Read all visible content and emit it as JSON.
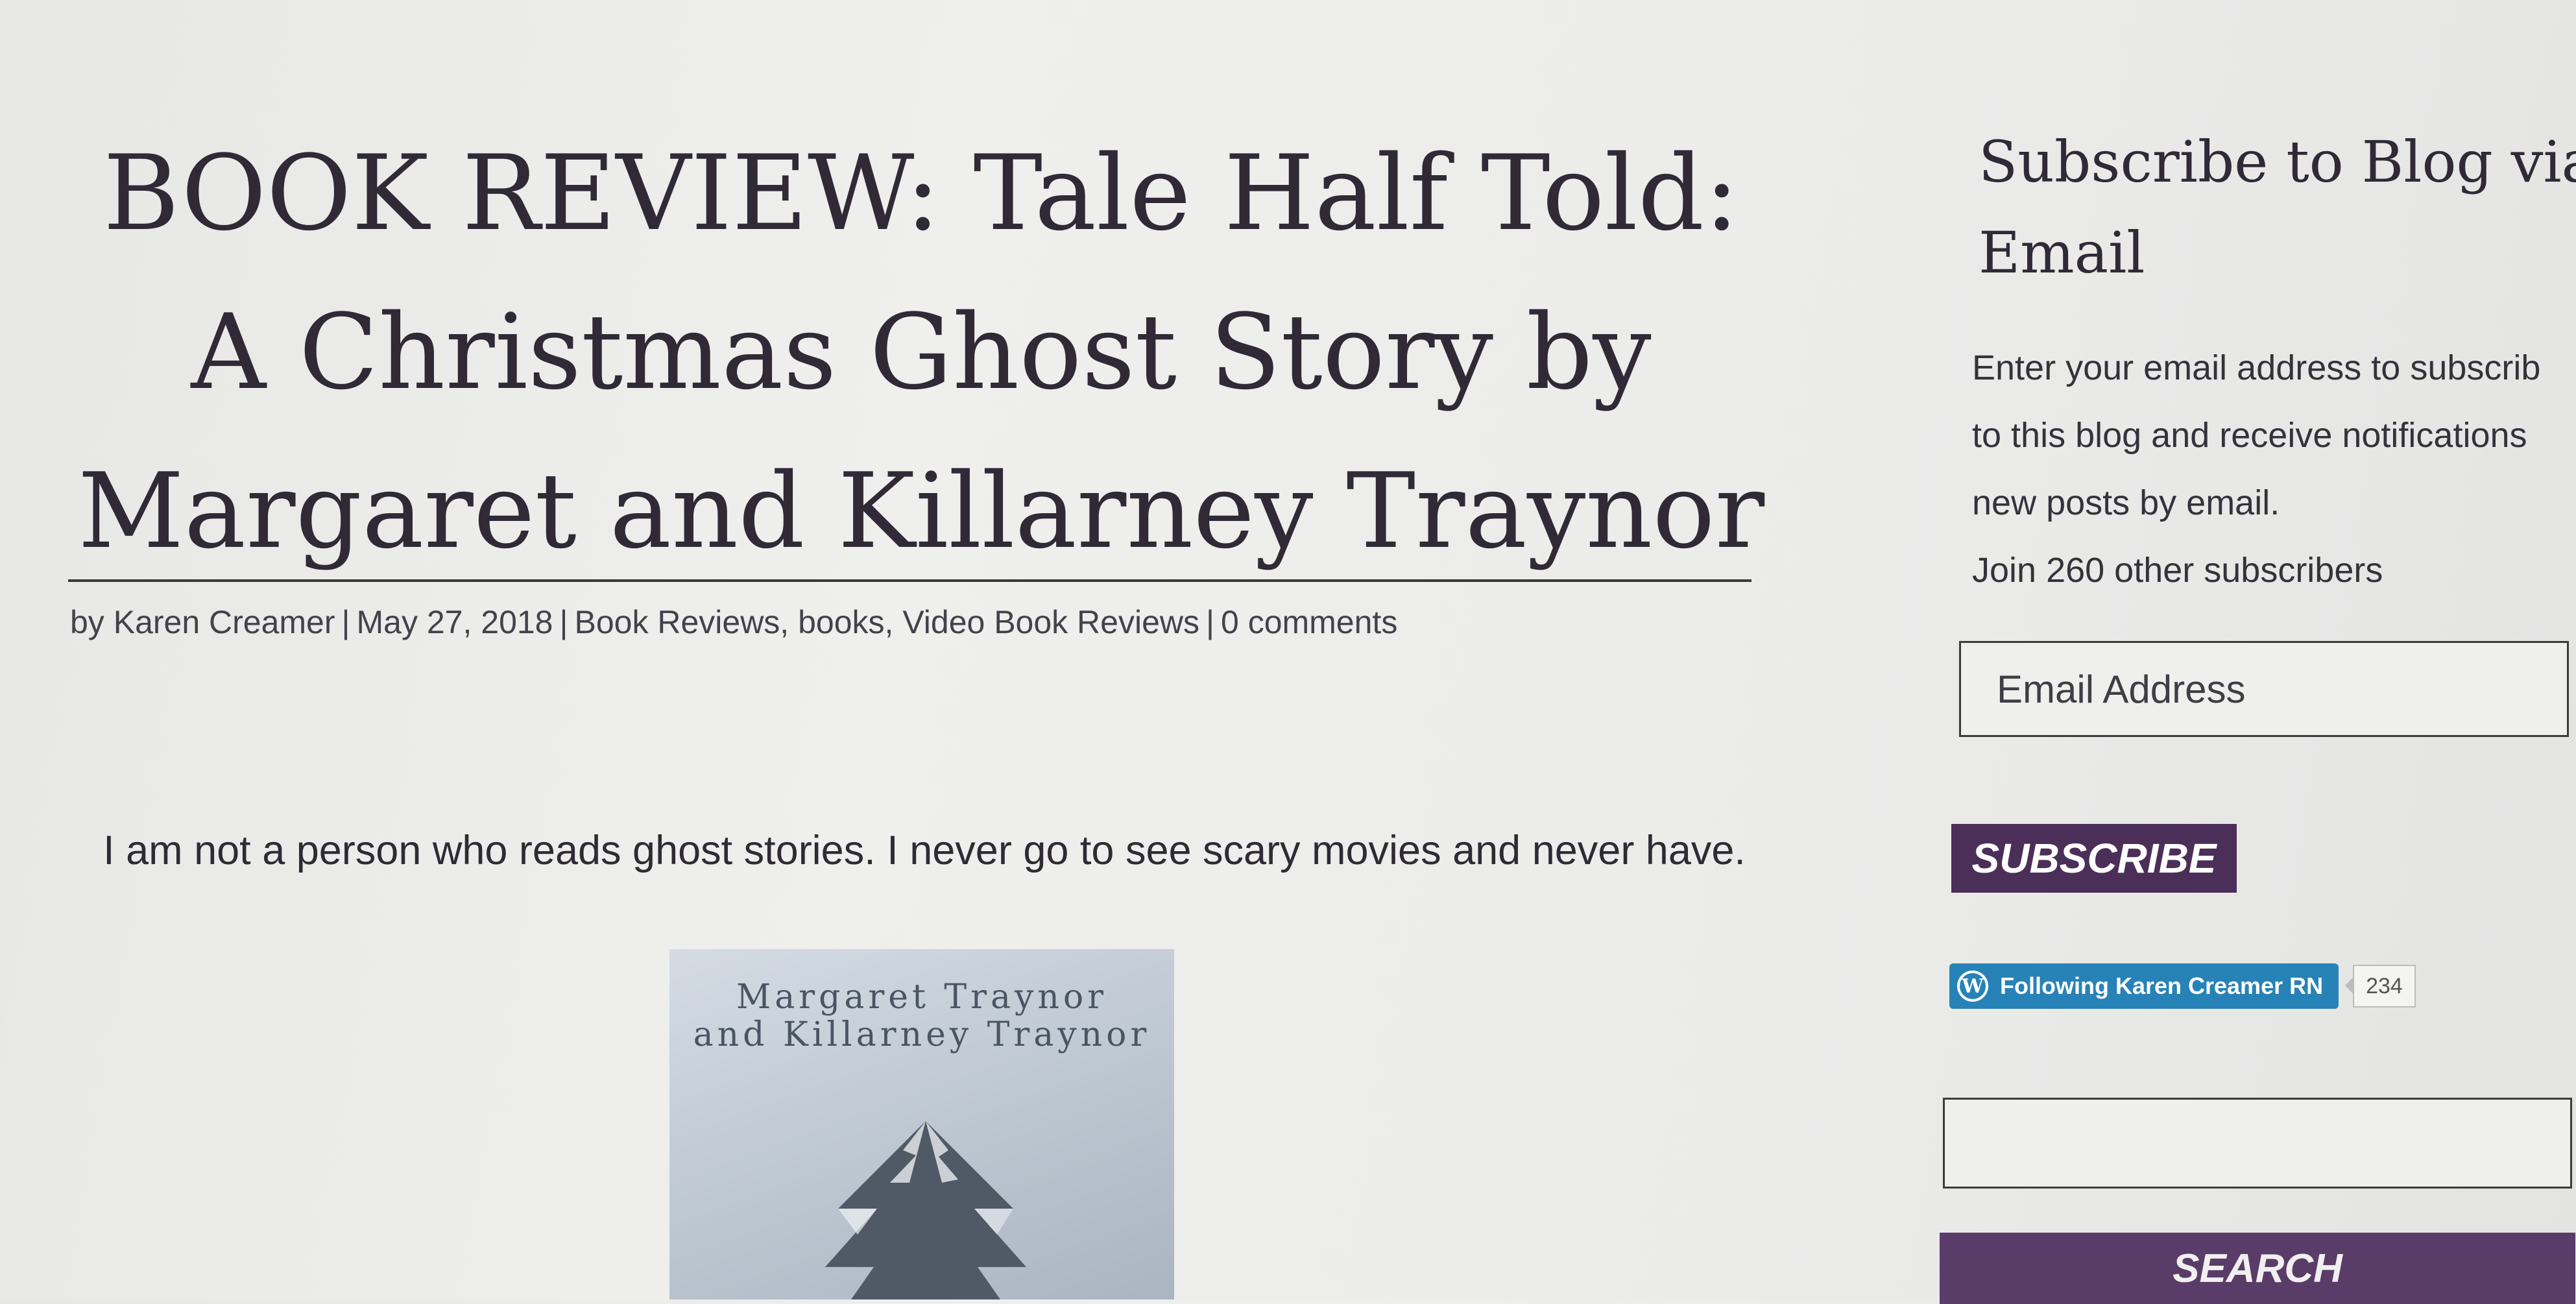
{
  "post": {
    "title": "BOOK REVIEW: Tale Half Told: A Christmas Ghost Story by Margaret and Killarney Traynor",
    "meta": {
      "by_prefix": "by",
      "author": "Karen Creamer",
      "date": "May 27, 2018",
      "categories": [
        "Book Reviews",
        "books",
        "Video Book Reviews"
      ],
      "comments": "0 comments"
    },
    "intro": "I am not a person who reads ghost stories. I never go to see scary movies and never have.",
    "cover": {
      "author_line1": "Margaret Traynor",
      "author_line2": "and Killarney Traynor"
    }
  },
  "sidebar": {
    "subscribe_widget": {
      "title": "Subscribe to Blog via Email",
      "desc_lines": [
        "Enter your email address to subscrib",
        "to this blog and receive notifications",
        "new posts by email."
      ],
      "subscribers": "Join 260 other subscribers",
      "email_placeholder": "Email Address",
      "button_label": "SUBSCRIBE"
    },
    "follow": {
      "label": "Following Karen Creamer RN",
      "count": "234",
      "icon": "wordpress-icon",
      "color": "#2782b8"
    },
    "search": {
      "value": "",
      "button_label": "SEARCH"
    }
  },
  "colors": {
    "accent": "#4b2f58",
    "search_button": "#5a3c68",
    "follow_button": "#2782b8"
  }
}
